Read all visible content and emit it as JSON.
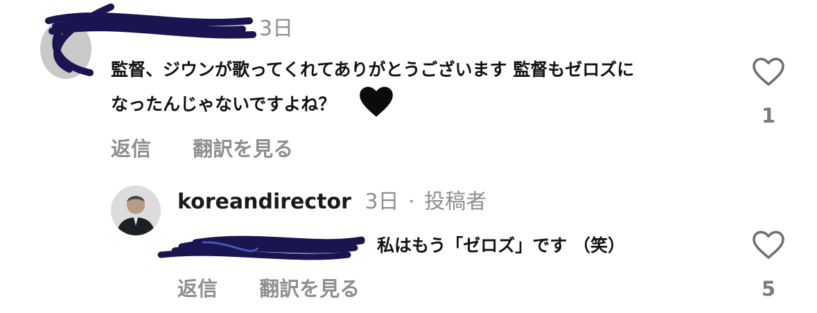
{
  "comments": [
    {
      "timestamp": "3日",
      "text_line1": "監督、ジウンが歌ってくれてありがとうございます 監督もゼロズに",
      "text_line2": "なったんじゃないですよね？",
      "emoji": "🖤",
      "reply_label": "返信",
      "translate_label": "翻訳を見る",
      "like_count": "1"
    },
    {
      "username": "koreandirector",
      "timestamp": "3日",
      "separator": "·",
      "author_badge": "投稿者",
      "text": "私はもう「ゼロズ」です （笑）",
      "reply_label": "返信",
      "translate_label": "翻訳を見る",
      "like_count": "5"
    }
  ],
  "colors": {
    "muted_text": "#8e8e8e",
    "body_text": "#111111",
    "scribble": "#1a1450",
    "mention": "#3d5ab8"
  },
  "icons": {
    "like": "heart-outline-icon",
    "emoji": "black-heart-emoji"
  }
}
